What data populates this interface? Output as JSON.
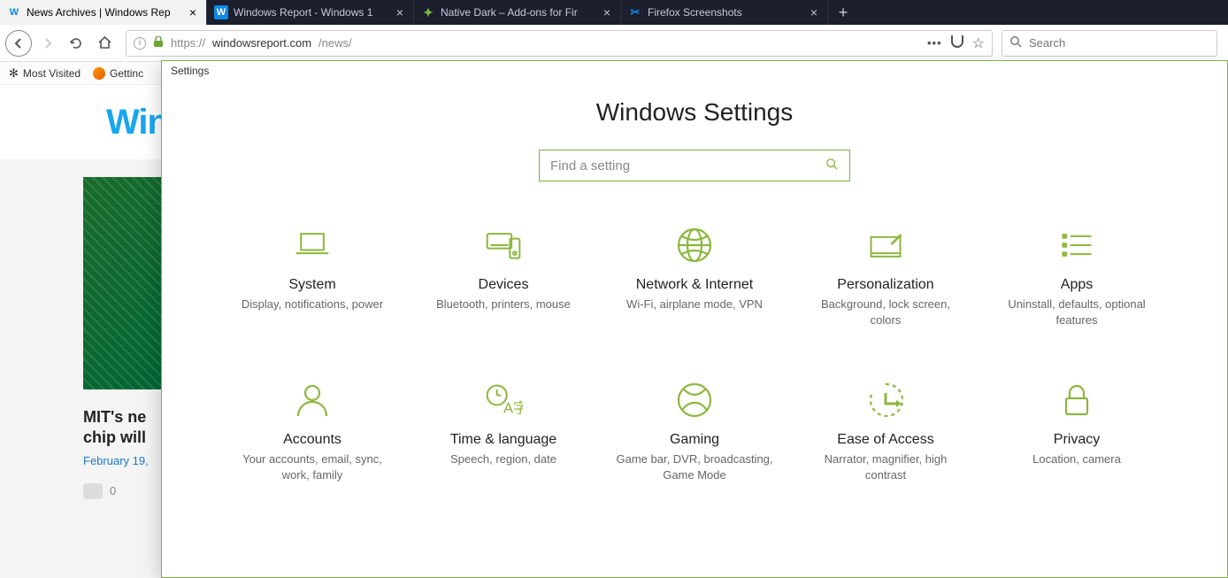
{
  "tabs": [
    {
      "title": "News Archives | Windows Rep",
      "active": true
    },
    {
      "title": "Windows Report - Windows 1",
      "active": false
    },
    {
      "title": "Native Dark – Add-ons for Fir",
      "active": false
    },
    {
      "title": "Firefox Screenshots",
      "active": false
    }
  ],
  "url": {
    "scheme": "https://",
    "host": "windowsreport.com",
    "path": "/news/"
  },
  "searchbar_placeholder": "Search",
  "bookmarks": {
    "most_visited": "Most Visited",
    "getting": "Gettinc"
  },
  "page": {
    "logo": "Win",
    "article_title_l1": "MIT's ne",
    "article_title_l2": "chip will",
    "article_date": "February 19,",
    "article_comments": "0"
  },
  "settings": {
    "window_title": "Settings",
    "page_title": "Windows Settings",
    "search_placeholder": "Find a setting",
    "tiles": [
      {
        "title": "System",
        "desc": "Display, notifications, power"
      },
      {
        "title": "Devices",
        "desc": "Bluetooth, printers, mouse"
      },
      {
        "title": "Network & Internet",
        "desc": "Wi-Fi, airplane mode, VPN"
      },
      {
        "title": "Personalization",
        "desc": "Background, lock screen, colors"
      },
      {
        "title": "Apps",
        "desc": "Uninstall, defaults, optional features"
      },
      {
        "title": "Accounts",
        "desc": "Your accounts, email, sync, work, family"
      },
      {
        "title": "Time & language",
        "desc": "Speech, region, date"
      },
      {
        "title": "Gaming",
        "desc": "Game bar, DVR, broadcasting, Game Mode"
      },
      {
        "title": "Ease of Access",
        "desc": "Narrator, magnifier, high contrast"
      },
      {
        "title": "Privacy",
        "desc": "Location, camera"
      }
    ]
  }
}
